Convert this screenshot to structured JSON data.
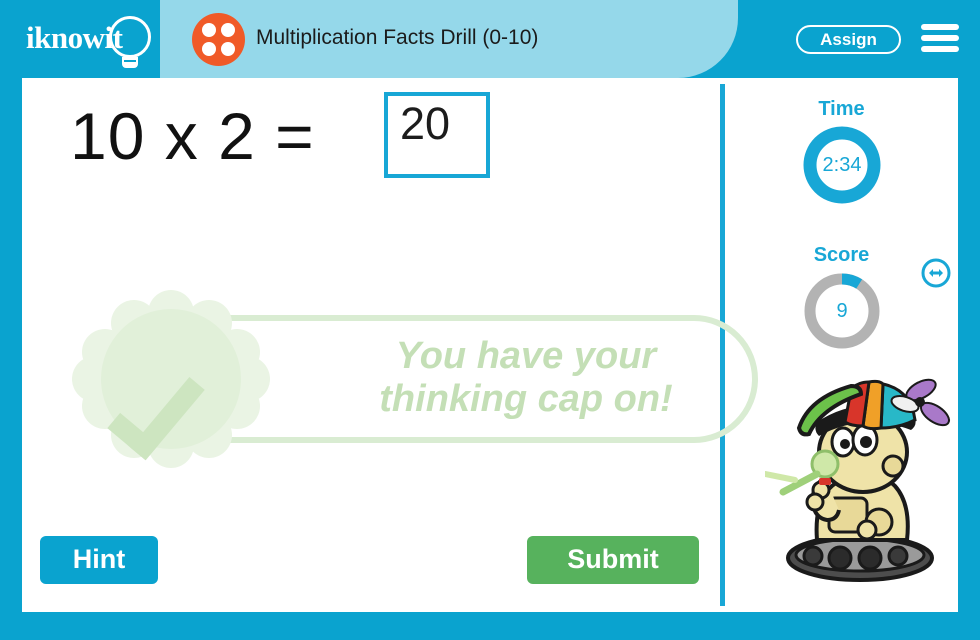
{
  "header": {
    "logo_text": "iknowit",
    "logo_icon": "lightbulb-icon",
    "title": "Multiplication Facts Drill (0-10)",
    "title_icon": "dice-four-icon",
    "assign_label": "Assign",
    "menu_icon": "hamburger-menu-icon",
    "bg_color": "#0aa3cf",
    "tab_color": "#95d8ea",
    "dice_color": "#f05a28"
  },
  "question": {
    "expression": "10 x 2 =",
    "operand_a": "10",
    "operator": "x",
    "operand_b": "2",
    "equals": "=",
    "answer_value": "20",
    "answer_placeholder": ""
  },
  "feedback": {
    "message_line1": "You have your",
    "message_line2": "thinking cap on!",
    "seal_icon": "check-seal-icon",
    "color": "#c4dfb6"
  },
  "actions": {
    "hint_label": "Hint",
    "submit_label": "Submit",
    "hint_color": "#0aa3cf",
    "submit_color": "#57b25d"
  },
  "sidebar": {
    "time_label": "Time",
    "time_value": "2:34",
    "time_percent": 100,
    "score_label": "Score",
    "score_value": "9",
    "score_percent": 9,
    "accent_color": "#18a7d6",
    "track_color": "#b3b3b3",
    "mascot_icon": "robot-mascot-icon",
    "resize_icon": "resize-horizontal-icon"
  }
}
